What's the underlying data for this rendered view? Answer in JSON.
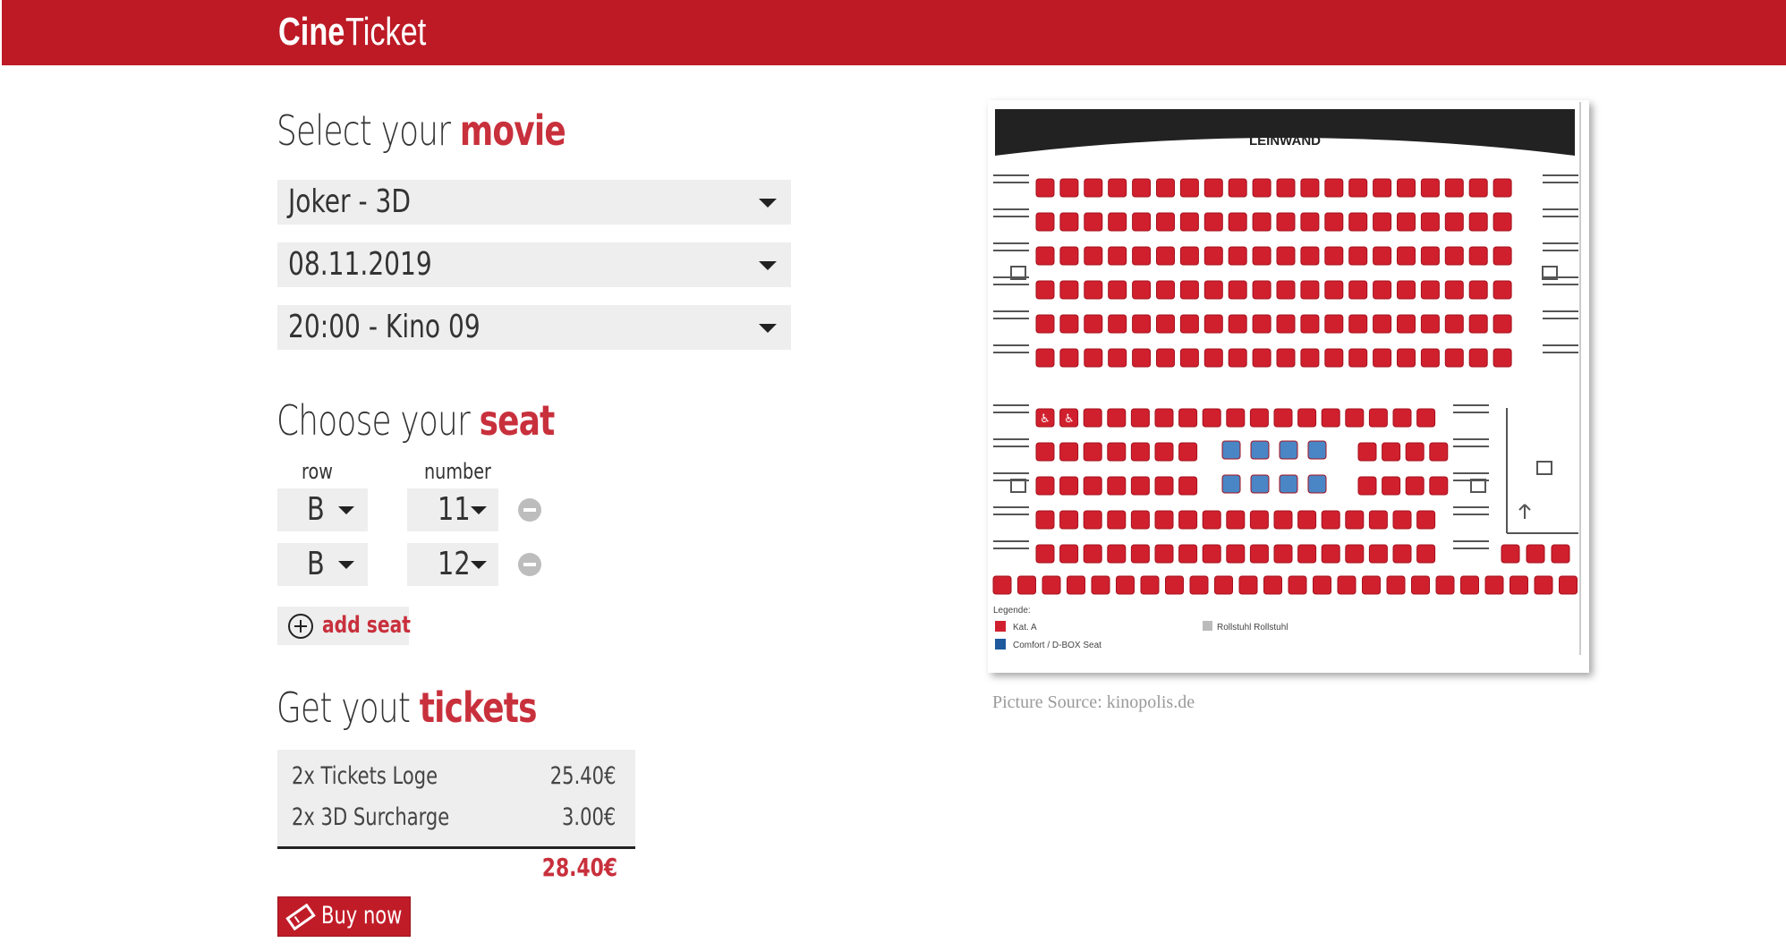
{
  "header": {
    "logo_bold": "Cine",
    "logo_regular": "Ticket",
    "background": "#bd1a26"
  },
  "movie_section": {
    "title_prefix": "Select your ",
    "title_highlight": "movie",
    "movie": "Joker - 3D",
    "date": "08.11.2019",
    "showtime": "20:00 - Kino 09"
  },
  "seat_section": {
    "title_prefix": "Choose your ",
    "title_highlight": "seat",
    "row_label": "row",
    "number_label": "number",
    "seats": [
      {
        "row": "B",
        "number": "11"
      },
      {
        "row": "B",
        "number": "12"
      }
    ],
    "add_seat_label": "add seat"
  },
  "ticket_section": {
    "title_prefix": "Get yout ",
    "title_highlight": "tickets",
    "items": [
      {
        "label": "2x Tickets Loge",
        "price": "25.40€"
      },
      {
        "label": "2x 3D Surcharge",
        "price": "3.00€"
      }
    ],
    "total": "28.40€",
    "buy_label": "Buy now"
  },
  "seat_plan": {
    "screen_label": "LEINWAND",
    "legend_title": "Legende:",
    "legend": [
      {
        "label": "Kat. A",
        "color": "#d0202e"
      },
      {
        "label": "Comfort / D-BOX Seat",
        "color": "#1f5a9c"
      },
      {
        "label": "Rollstuhl  Rollstuhl",
        "icon": "wheelchair-icon"
      }
    ],
    "caption": "Picture Source: kinopolis.de"
  },
  "colors": {
    "accent": "#c8303c",
    "seat_red": "#d0202e",
    "seat_blue": "#4a86c5"
  }
}
